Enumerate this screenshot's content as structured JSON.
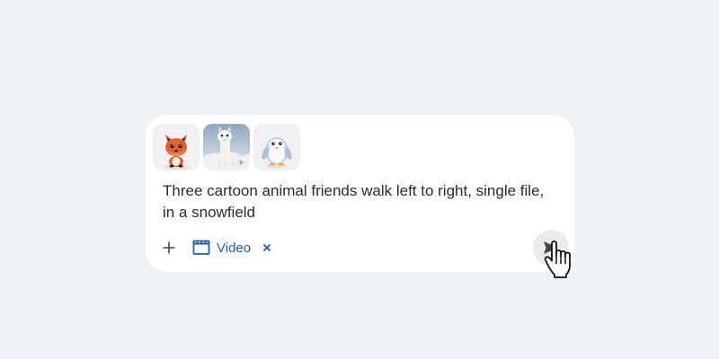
{
  "prompt": {
    "text_line1": "Three cartoon animal friends walk left to right, single file,",
    "text_line2": "in a snowfield"
  },
  "attachments": [
    {
      "icon": "fox-image"
    },
    {
      "icon": "llama-image"
    },
    {
      "icon": "penguin-image"
    }
  ],
  "toolbar": {
    "add_icon": "plus-icon",
    "chip_label": "Video",
    "chip_icon": "clapperboard-icon",
    "chip_close_icon": "close-icon",
    "send_icon": "send-icon"
  },
  "colors": {
    "background": "#eff2f4",
    "card": "#ffffff",
    "accent": "#1d5fb8",
    "text": "#2a2b2e",
    "send_button": "#e9ebee"
  }
}
